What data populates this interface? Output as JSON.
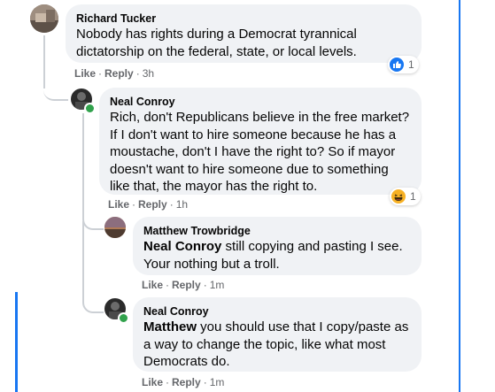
{
  "comments": [
    {
      "author": "Richard Tucker",
      "text": "Nobody has rights during a Democrat tyrannical dictatorship on the federal, state, or local levels.",
      "actions": {
        "like": "Like",
        "reply": "Reply",
        "time": "3h"
      },
      "reaction": {
        "icon": "like-icon",
        "count": "1"
      }
    },
    {
      "author": "Neal Conroy",
      "text": "Rich, don't Republicans believe in the free market? If I don't want to hire someone because he has a moustache, don't I have the right to? So if mayor doesn't want to hire someone due to something like that, the mayor has the right to.",
      "actions": {
        "like": "Like",
        "reply": "Reply",
        "time": "1h"
      },
      "reaction": {
        "icon": "haha-icon",
        "count": "1"
      }
    },
    {
      "author": "Matthew Trowbridge",
      "mention": "Neal Conroy",
      "text": " still copying and pasting I see. Your nothing but a troll.",
      "actions": {
        "like": "Like",
        "reply": "Reply",
        "time": "1m"
      }
    },
    {
      "author": "Neal Conroy",
      "mention": "Matthew",
      "text": " you should use that I copy/paste as a way to change the topic, like what most Democrats do.",
      "actions": {
        "like": "Like",
        "reply": "Reply",
        "time": "1m"
      }
    }
  ],
  "colors": {
    "accent": "#1877f2",
    "online": "#31a24c",
    "bubble": "#f0f2f5",
    "meta": "#65676b"
  }
}
